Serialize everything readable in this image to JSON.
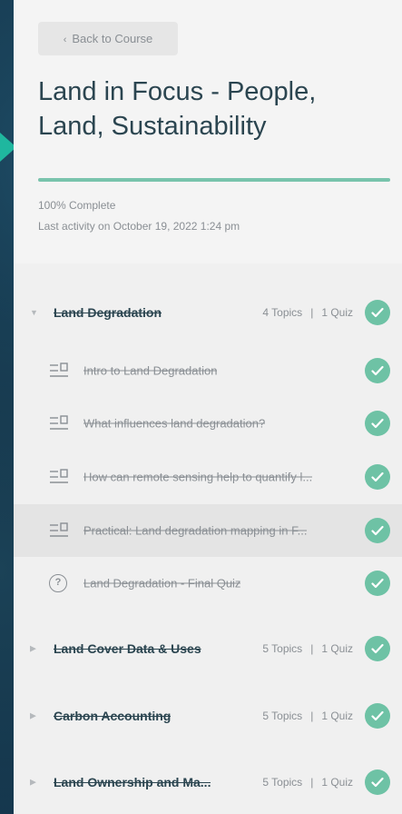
{
  "header": {
    "back_label": "Back to Course",
    "course_title": "Land in Focus - People, Land, Sustainability",
    "progress_percent": 100,
    "percent_label": "100% Complete",
    "last_activity": "Last activity on October 19, 2022 1:24 pm"
  },
  "lessons": [
    {
      "title": "Land Degradation",
      "topics": "4 Topics",
      "quiz": "1 Quiz",
      "completed": true,
      "expanded": true,
      "items": [
        {
          "type": "topic",
          "title": "Intro to Land Degradation",
          "completed": true
        },
        {
          "type": "topic",
          "title": "What influences land degradation?",
          "completed": true
        },
        {
          "type": "topic",
          "title": "How can remote sensing help to quantify l...",
          "completed": true
        },
        {
          "type": "topic",
          "title": "Practical: Land degradation mapping in F...",
          "completed": true
        },
        {
          "type": "quiz",
          "title": "Land Degradation - Final Quiz",
          "completed": true
        }
      ]
    },
    {
      "title": "Land Cover Data & Uses",
      "topics": "5 Topics",
      "quiz": "1 Quiz",
      "completed": true,
      "expanded": false
    },
    {
      "title": "Carbon Accounting",
      "topics": "5 Topics",
      "quiz": "1 Quiz",
      "completed": true,
      "expanded": false
    },
    {
      "title": "Land Ownership and Ma...",
      "topics": "5 Topics",
      "quiz": "1 Quiz",
      "completed": true,
      "expanded": false
    }
  ],
  "icons": {
    "back": "chevron-left-icon",
    "expanded": "triangle-down-icon",
    "collapsed": "triangle-right-icon",
    "topic": "topic-lines-icon",
    "quiz": "question-circle-icon",
    "complete": "check-circle-icon"
  },
  "colors": {
    "accent": "#79c3ac",
    "check": "#6ec2a5",
    "title": "#2b4550",
    "muted": "#8a8f94"
  }
}
